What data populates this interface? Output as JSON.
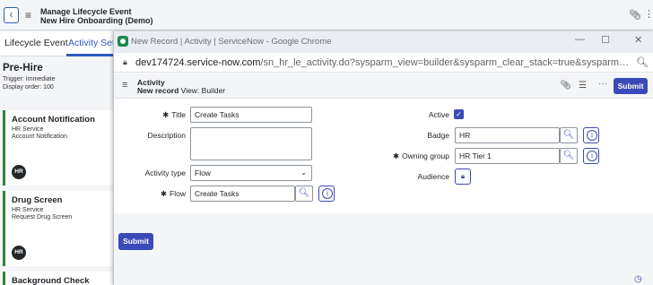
{
  "background": {
    "header": {
      "title_line1": "Manage Lifecycle Event",
      "title_line2": "New Hire Onboarding (Demo)"
    },
    "tabs": [
      {
        "label": "Lifecycle Event"
      },
      {
        "label": "Activity Sets"
      }
    ],
    "stage": {
      "title": "Pre-Hire",
      "trigger": "Trigger: Immediate",
      "display_order": "Display order: 100"
    },
    "cards": [
      {
        "title": "Account Notification",
        "line1": "HR Service",
        "line2": "Account Notification",
        "badge": "HR"
      },
      {
        "title": "Drug Screen",
        "line1": "HR Service",
        "line2": "Request Drug Screen",
        "badge": "HR"
      },
      {
        "title": "Background Check"
      }
    ]
  },
  "popup": {
    "window_title": "New Record | Activity | ServiceNow - Google Chrome",
    "url_host": "dev174724.service-now.com",
    "url_path": "/sn_hr_le_activity.do?sysparm_view=builder&sysparm_clear_stack=true&sysparm_referrin...",
    "form_header": {
      "title": "Activity",
      "subtitle_bold": "New record",
      "subtitle_view": "View: Builder",
      "submit_label": "Submit"
    },
    "form": {
      "title_label": "Title",
      "title_value": "Create Tasks",
      "description_label": "Description",
      "activity_type_label": "Activity type",
      "activity_type_value": "Flow",
      "flow_label": "Flow",
      "flow_value": "Create Tasks",
      "active_label": "Active",
      "active_checked": true,
      "badge_label": "Badge",
      "badge_value": "HR",
      "owning_group_label": "Owning group",
      "owning_group_value": "HR Tier 1",
      "audience_label": "Audience",
      "required_marker": "✱"
    },
    "footer": {
      "submit_label": "Submit"
    }
  },
  "colors": {
    "accent": "#3c4ab8",
    "card_border": "#2e8540",
    "badge_bg": "#23262b"
  }
}
